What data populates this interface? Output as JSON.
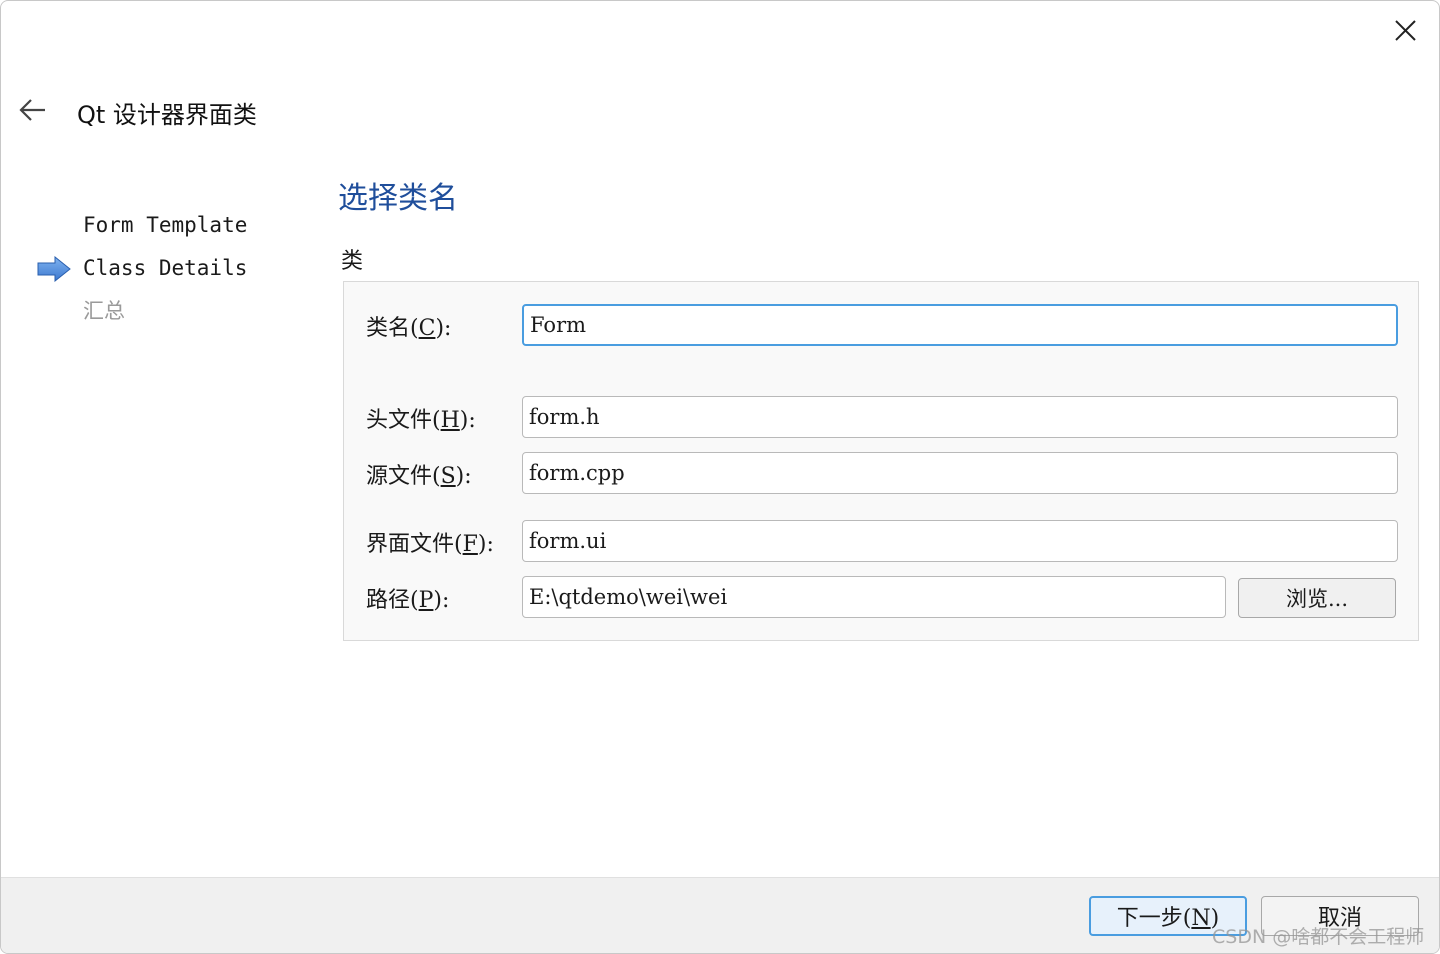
{
  "window": {
    "title": "Qt 设计器界面类"
  },
  "steps": [
    {
      "label": "Form Template",
      "state": "done"
    },
    {
      "label": "Class Details",
      "state": "current"
    },
    {
      "label": "汇总",
      "state": "pending"
    }
  ],
  "page": {
    "heading": "选择类名",
    "group_title": "类"
  },
  "fields": {
    "class_name": {
      "label_pre": "类名(",
      "mnemonic": "C",
      "label_post": "):",
      "value": "Form"
    },
    "header_file": {
      "label_pre": "头文件(",
      "mnemonic": "H",
      "label_post": "):",
      "value": "form.h"
    },
    "source_file": {
      "label_pre": "源文件(",
      "mnemonic": "S",
      "label_post": "):",
      "value": "form.cpp"
    },
    "ui_file": {
      "label_pre": "界面文件(",
      "mnemonic": "F",
      "label_post": "):",
      "value": "form.ui"
    },
    "path": {
      "label_pre": "路径(",
      "mnemonic": "P",
      "label_post": "):",
      "value": "E:\\qtdemo\\wei\\wei"
    }
  },
  "buttons": {
    "browse": "浏览...",
    "next_pre": "下一步(",
    "next_mnemonic": "N",
    "next_post": ")",
    "cancel": "取消"
  },
  "watermark": "CSDN @啥都不会工程师",
  "colors": {
    "accent": "#4a9de0",
    "heading": "#1f4e9b",
    "arrow": "#4a86d8"
  },
  "icons": {
    "close": "close-icon",
    "back": "back-arrow-icon",
    "current_step": "step-arrow-icon"
  }
}
